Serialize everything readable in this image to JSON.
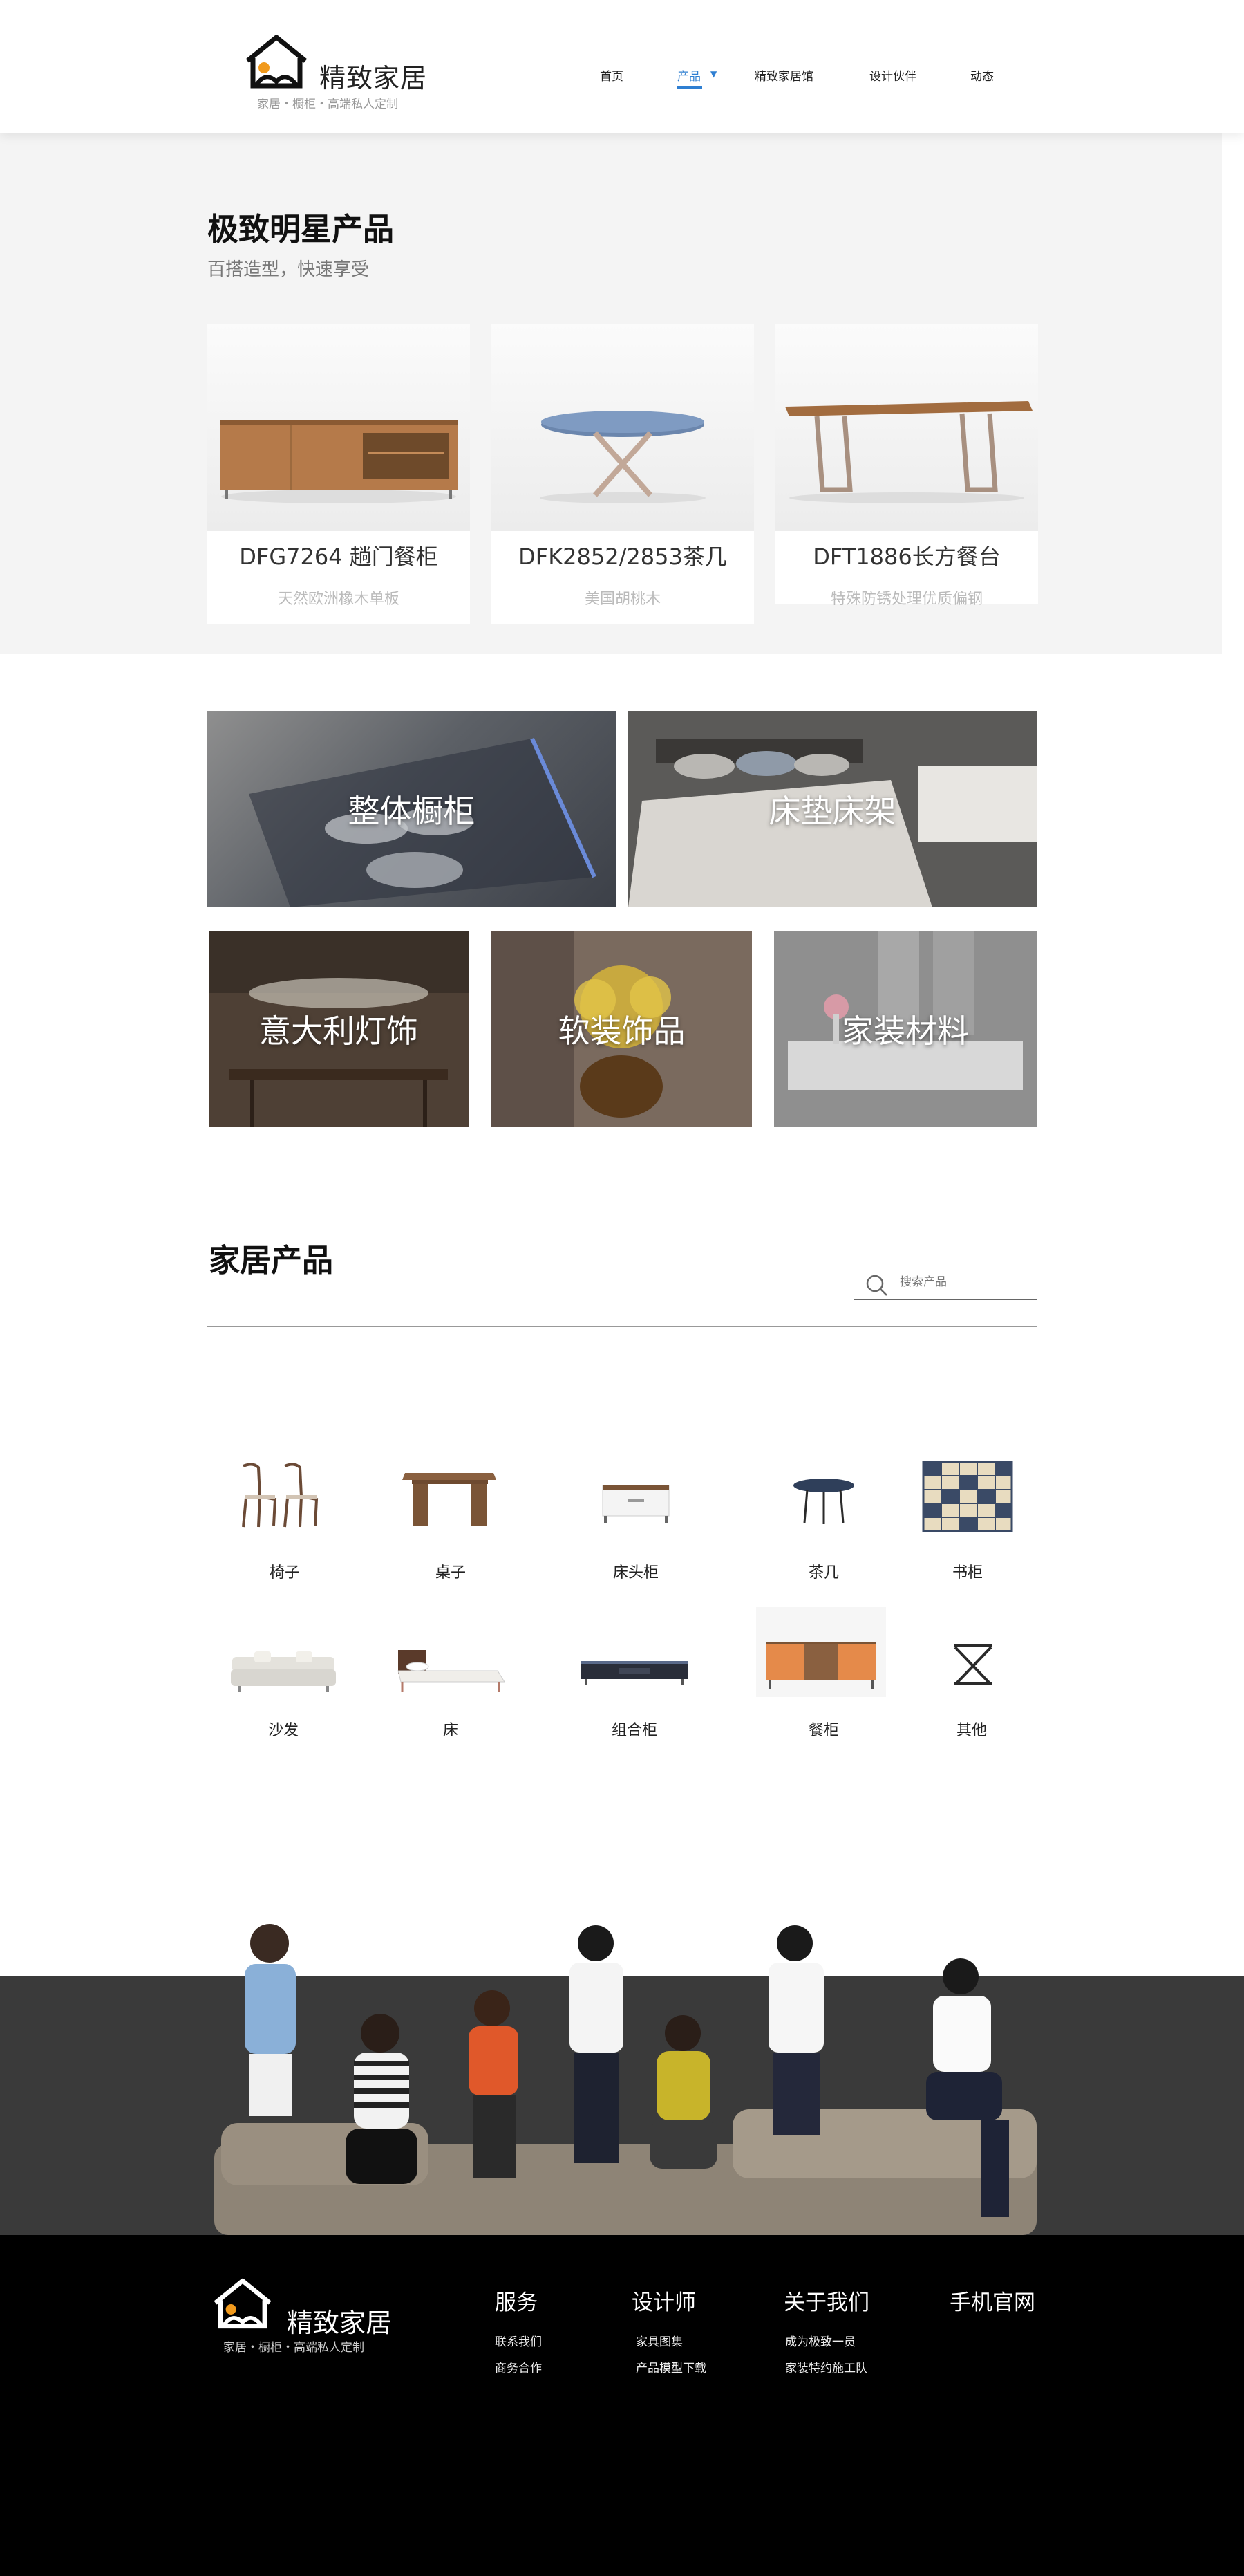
{
  "brand": {
    "name": "精致家居",
    "tagline": "家居・橱柜・高端私人定制",
    "accent_color": "#2f7fd2",
    "logo_orange": "#f19a1d"
  },
  "nav": {
    "items": [
      {
        "label": "首页",
        "active": false
      },
      {
        "label": "产品",
        "active": true
      },
      {
        "label": "精致家居馆",
        "active": false
      },
      {
        "label": "设计伙伴",
        "active": false
      },
      {
        "label": "动态",
        "active": false
      }
    ],
    "dropdown_icon": "caret-down-icon"
  },
  "star_products": {
    "title": "极致明星产品",
    "subtitle": "百搭造型，快速享受",
    "cards": [
      {
        "name": "DFG7264 趟门餐柜",
        "desc": "天然欧洲橡木单板"
      },
      {
        "name": "DFK2852/2853茶几",
        "desc": "美国胡桃木"
      },
      {
        "name": "DFT1886长方餐台",
        "desc": "特殊防锈处理优质偏钢"
      }
    ]
  },
  "categories": [
    {
      "label": "整体橱柜"
    },
    {
      "label": "床垫床架"
    },
    {
      "label": "意大利灯饰"
    },
    {
      "label": "软装饰品"
    },
    {
      "label": "家装材料"
    }
  ],
  "home_products": {
    "title": "家居产品",
    "search_placeholder": "搜索产品",
    "row1": [
      {
        "label": "椅子",
        "icon": "chair-icon"
      },
      {
        "label": "桌子",
        "icon": "table-icon"
      },
      {
        "label": "床头柜",
        "icon": "nightstand-icon"
      },
      {
        "label": "茶几",
        "icon": "coffee-table-icon"
      },
      {
        "label": "书柜",
        "icon": "bookcase-icon"
      }
    ],
    "row2": [
      {
        "label": "沙发",
        "icon": "sofa-icon"
      },
      {
        "label": "床",
        "icon": "bed-icon"
      },
      {
        "label": "组合柜",
        "icon": "tv-cabinet-icon"
      },
      {
        "label": "餐柜",
        "icon": "sideboard-icon"
      },
      {
        "label": "其他",
        "icon": "folding-stool-icon"
      }
    ]
  },
  "footer": {
    "brand_name": "精致家居",
    "brand_tagline": "家居・橱柜・高端私人定制",
    "columns": [
      {
        "title": "服务",
        "links": [
          "联系我们",
          "商务合作"
        ]
      },
      {
        "title": "设计师",
        "links": [
          "家具图集",
          "产品模型下载"
        ]
      },
      {
        "title": "关于我们",
        "links": [
          "成为极致一员",
          "家装特约施工队"
        ]
      },
      {
        "title": "手机官网",
        "links": []
      }
    ]
  }
}
